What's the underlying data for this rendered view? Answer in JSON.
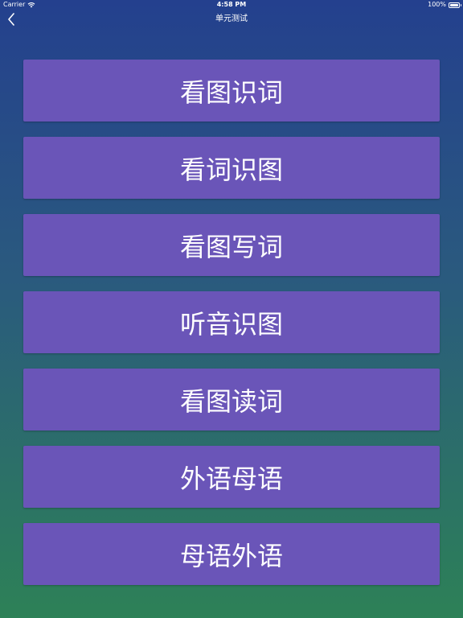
{
  "status_bar": {
    "carrier": "Carrier",
    "time": "4:58 PM",
    "battery": "100%"
  },
  "nav": {
    "title": "单元测试",
    "back_icon": "chevron-left-icon"
  },
  "menu": {
    "items": [
      {
        "label": "看图识词"
      },
      {
        "label": "看词识图"
      },
      {
        "label": "看图写词"
      },
      {
        "label": "听音识图"
      },
      {
        "label": "看图读词"
      },
      {
        "label": "外语母语"
      },
      {
        "label": "母语外语"
      }
    ]
  },
  "colors": {
    "button": "#6a55b8",
    "gradient_top": "#24408e",
    "gradient_bottom": "#2d8157"
  }
}
